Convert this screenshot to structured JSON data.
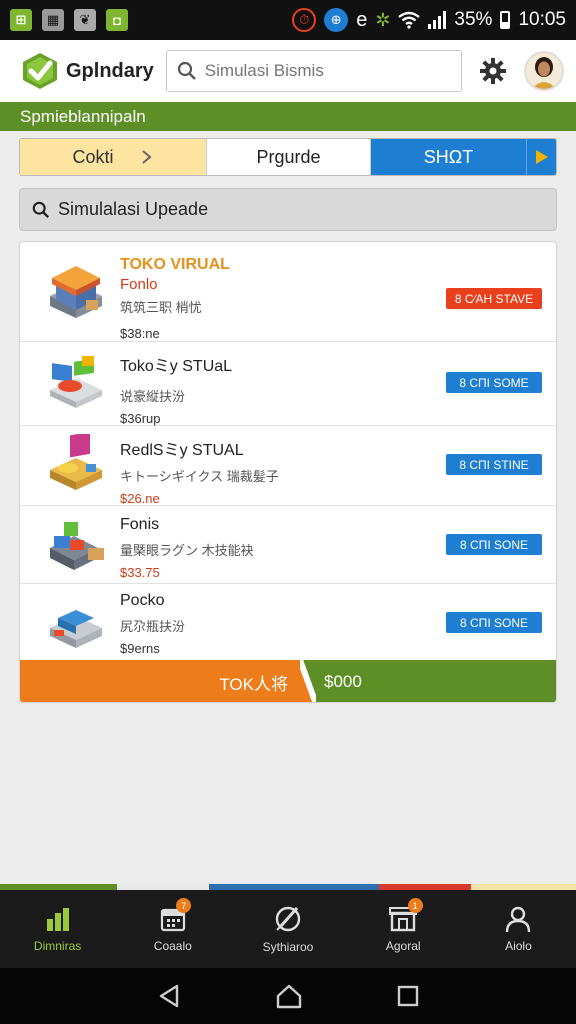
{
  "status_bar": {
    "left_icons": [
      "app-icon-1",
      "app-icon-2",
      "app-icon-3",
      "app-icon-4"
    ],
    "right_icons": [
      "alarm-icon",
      "vpn-icon",
      "e-icon",
      "android-icon",
      "wifi-icon",
      "signal-icon"
    ],
    "battery": "35%",
    "time": "10:05"
  },
  "header": {
    "app_name": "Gplndary",
    "search_placeholder": "Simulasi Bismis"
  },
  "banner": {
    "text": "Spmieblannipaln"
  },
  "tabs": [
    {
      "label": "Cokti"
    },
    {
      "label": "Prgurde"
    },
    {
      "label": "SHΩT"
    }
  ],
  "secondary_search": {
    "text": "Simulalasi Upeade"
  },
  "items": [
    {
      "title": "TOKO VIRUAL",
      "subtitle": "Fonlo",
      "desc": "筑筑三职 梢忧",
      "price": "$38:ne",
      "button": "8 C⁄AH STAVE",
      "button_color": "#e8401c"
    },
    {
      "title": "Tokoミy STUaL",
      "subtitle": "",
      "desc": "说豪縦扶汾",
      "price": "$36rup",
      "button": "8 CΠI SOME",
      "button_color": "#1e7fd2"
    },
    {
      "title": "RedlSミy STUAL",
      "subtitle": "",
      "desc": "キトーシギイクス 瑞裁髪子",
      "price": "$26.ne",
      "button": "8 CΠI STINE",
      "button_color": "#1e7fd2"
    },
    {
      "title": "Fonis",
      "subtitle": "",
      "desc": "量槩眼ラグン 木技能袂",
      "price": "$33.75",
      "button": "8 CΠI SONE",
      "button_color": "#1e7fd2"
    },
    {
      "title": "Pocko",
      "subtitle": "",
      "desc": "尻尕瓶扶汾",
      "price": "$9erns",
      "button": "8 CΠI SONE",
      "button_color": "#1e7fd2"
    }
  ],
  "total": {
    "left_label": "TOK人将",
    "right_label": "$000"
  },
  "bottom_nav": [
    {
      "label": "Dimniras",
      "icon": "chart-icon",
      "badge": ""
    },
    {
      "label": "Coaalo",
      "icon": "calendar-icon",
      "badge": "7"
    },
    {
      "label": "Sythiaroo",
      "icon": "compass-icon",
      "badge": ""
    },
    {
      "label": "Agoral",
      "icon": "store-icon",
      "badge": "1"
    },
    {
      "label": "Aiolo",
      "icon": "user-icon",
      "badge": ""
    }
  ],
  "colors": {
    "green": "#5e8f26",
    "orange": "#ed7d1a",
    "blue": "#1e7fd2",
    "red": "#e8401c",
    "active_nav": "#9bc93a"
  }
}
